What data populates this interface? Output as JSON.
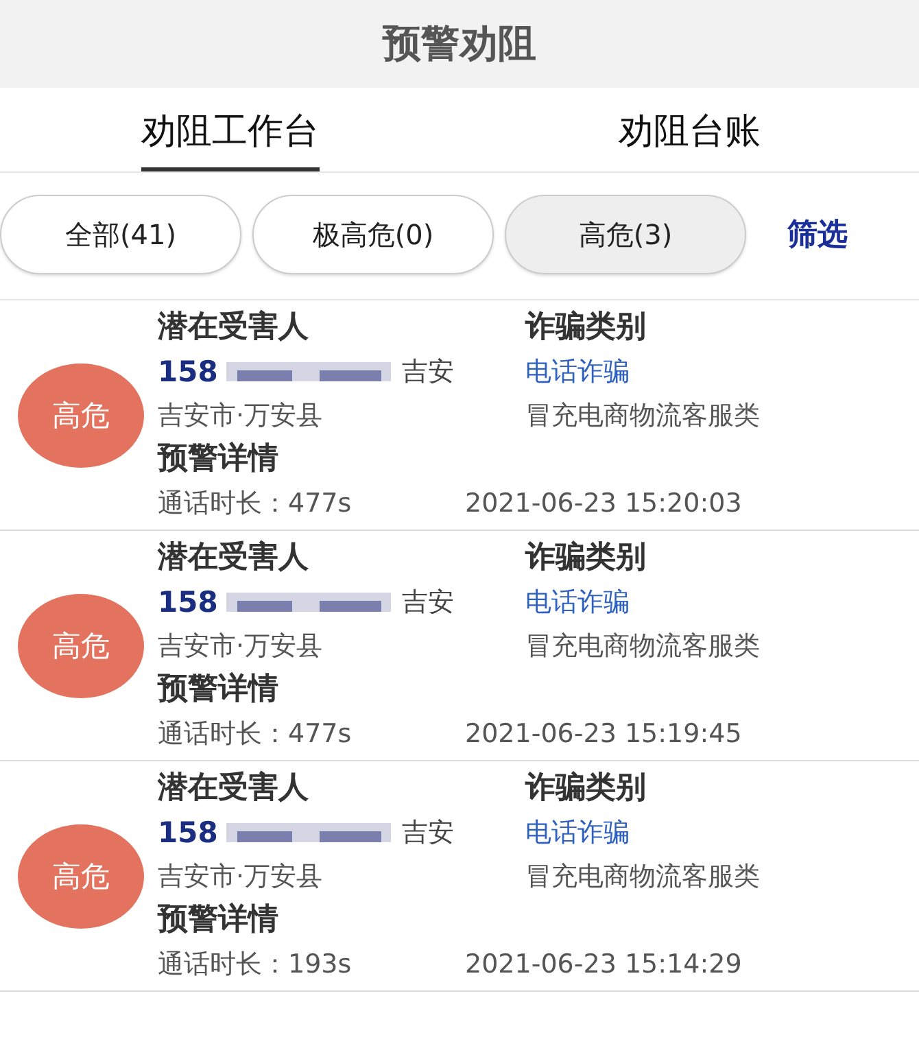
{
  "header": {
    "title": "预警劝阻"
  },
  "tabs": [
    {
      "label": "劝阻工作台",
      "selected": true
    },
    {
      "label": "劝阻台账",
      "selected": false
    }
  ],
  "filters": [
    {
      "label": "全部(41)",
      "selected": false
    },
    {
      "label": "极高危(0)",
      "selected": false
    },
    {
      "label": "高危(3)",
      "selected": true
    }
  ],
  "filter_link": "筛选",
  "alerts": [
    {
      "risk": "高危",
      "victim_label": "潜在受害人",
      "phone": "158",
      "city": "吉安",
      "location": "吉安市·万安县",
      "details_label": "预警详情",
      "duration": "通话时长：477s",
      "time": "2021-06-23 15:20:03",
      "fraud_label": "诈骗类别",
      "fraud_type": "电话诈骗",
      "fraud_subtype": "冒充电商物流客服类"
    },
    {
      "risk": "高危",
      "victim_label": "潜在受害人",
      "phone": "158",
      "city": "吉安",
      "location": "吉安市·万安县",
      "details_label": "预警详情",
      "duration": "通话时长：477s",
      "time": "2021-06-23 15:19:45",
      "fraud_label": "诈骗类别",
      "fraud_type": "电话诈骗",
      "fraud_subtype": "冒充电商物流客服类"
    },
    {
      "risk": "高危",
      "victim_label": "潜在受害人",
      "phone": "158",
      "city": "吉安",
      "location": "吉安市·万安县",
      "details_label": "预警详情",
      "duration": "通话时长：193s",
      "time": "2021-06-23 15:14:29",
      "fraud_label": "诈骗类别",
      "fraud_type": "电话诈骗",
      "fraud_subtype": "冒充电商物流客服类"
    }
  ]
}
